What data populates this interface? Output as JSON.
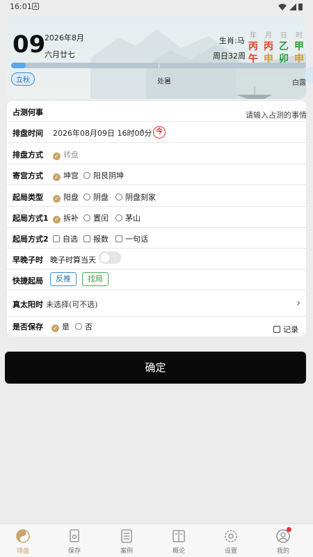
{
  "status": {
    "time": "16:01",
    "a_icon": "A"
  },
  "header": {
    "day": "09",
    "year_month": "2026年8月",
    "lunar": "六月廿七",
    "zodiac": "生肖:马",
    "week": "周日32周",
    "gz_heads": [
      "年",
      "月",
      "日",
      "时"
    ],
    "gz_row1": [
      "丙",
      "丙",
      "乙",
      "甲"
    ],
    "gz_row2": [
      "午",
      "申",
      "卯",
      "申"
    ],
    "solar_term_current": "立秋",
    "solar_term_next": "处暑",
    "solar_term_after": "白露",
    "progress_fraction": 0.05
  },
  "form": {
    "question_label": "占测何事",
    "question_placeholder": "请输入占测的事情",
    "time_label": "排盘时间",
    "time_value": "2026年08月09日 16时00分",
    "today_btn": "今",
    "method_label": "排盘方式",
    "method_opt": "转盘",
    "palace_label": "寄宫方式",
    "palace_opts": [
      "坤宫",
      "阳艮阴坤"
    ],
    "type_label": "起局类型",
    "type_opts": [
      "阳盘",
      "阴盘",
      "阴盘刻家"
    ],
    "mode1_label": "起局方式1",
    "mode1_opts": [
      "拆补",
      "置闰",
      "茅山"
    ],
    "mode2_label": "起局方式2",
    "mode2_opts": [
      "自选",
      "报数",
      "一句话"
    ],
    "zi_label": "早晚子时",
    "zi_text": "晚子时算当天",
    "quick_label": "快捷起局",
    "quick_btn1": "反推",
    "quick_btn2": "找局",
    "sun_label": "真太阳时",
    "sun_value": "未选择(可不选)",
    "save_label": "是否保存",
    "save_yes": "是",
    "save_no": "否",
    "record": "记录"
  },
  "confirm": "确定",
  "tabs": [
    "排盘",
    "保存",
    "案例",
    "概论",
    "设置",
    "我的"
  ],
  "colors": {
    "accent": "#c8a46a",
    "blue": "#3b8fd8",
    "green": "#4caa55",
    "fire": "#e0402e",
    "earth": "#e39a1b",
    "wood": "#2e9a43"
  }
}
